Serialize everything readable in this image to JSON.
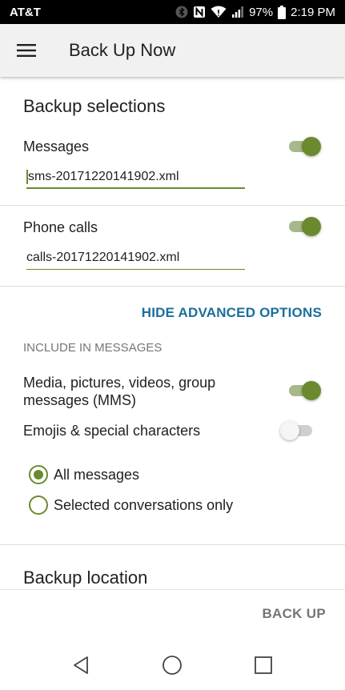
{
  "status_bar": {
    "carrier": "AT&T",
    "battery": "97%",
    "time": "2:19 PM",
    "icons": [
      "bluetooth-icon",
      "nfc-icon",
      "wifi-icon",
      "signal-icon",
      "battery-icon"
    ]
  },
  "app_bar": {
    "title": "Back Up Now",
    "menu_icon": "hamburger-menu-icon"
  },
  "backup_selections": {
    "title": "Backup selections",
    "messages": {
      "label": "Messages",
      "enabled": true,
      "filename": "sms-20171220141902.xml"
    },
    "phone_calls": {
      "label": "Phone calls",
      "enabled": true,
      "filename": "calls-20171220141902.xml"
    }
  },
  "advanced": {
    "link_label": "HIDE ADVANCED OPTIONS",
    "include_header": "INCLUDE IN MESSAGES",
    "mms": {
      "label_line1": "Media, pictures, videos, group",
      "label_line2": "messages (MMS)",
      "enabled": true
    },
    "emojis": {
      "label": "Emojis & special characters",
      "enabled": false
    },
    "options": [
      {
        "label": "All messages",
        "checked": true
      },
      {
        "label": "Selected conversations only",
        "checked": false
      }
    ]
  },
  "backup_location": {
    "title": "Backup location"
  },
  "actions": {
    "back_up_label": "BACK UP"
  },
  "nav_bar": {
    "icons": [
      "back-icon",
      "home-icon",
      "recents-icon"
    ]
  },
  "colors": {
    "accent": "#6b8a2f",
    "link": "#1a6f9c",
    "status_bar": "#000000",
    "app_bar": "#f1f1f1"
  }
}
